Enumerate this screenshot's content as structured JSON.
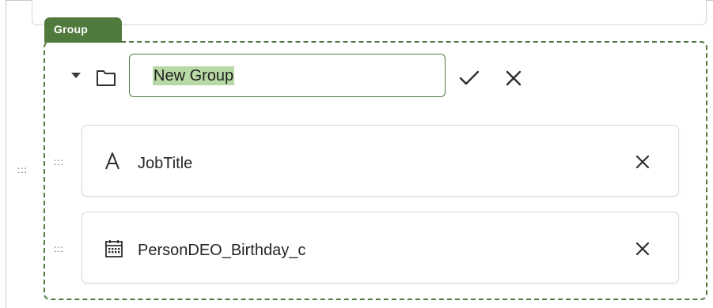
{
  "group": {
    "tab_label": "Group",
    "name_value": "New Group"
  },
  "fields": [
    {
      "label": "JobTitle",
      "icon": "text-type-icon"
    },
    {
      "label": "PersonDEO_Birthday_c",
      "icon": "calendar-icon"
    }
  ],
  "handle_glyph": ":::",
  "colors": {
    "accent": "#507a3c",
    "selection": "#b8d9a5"
  }
}
